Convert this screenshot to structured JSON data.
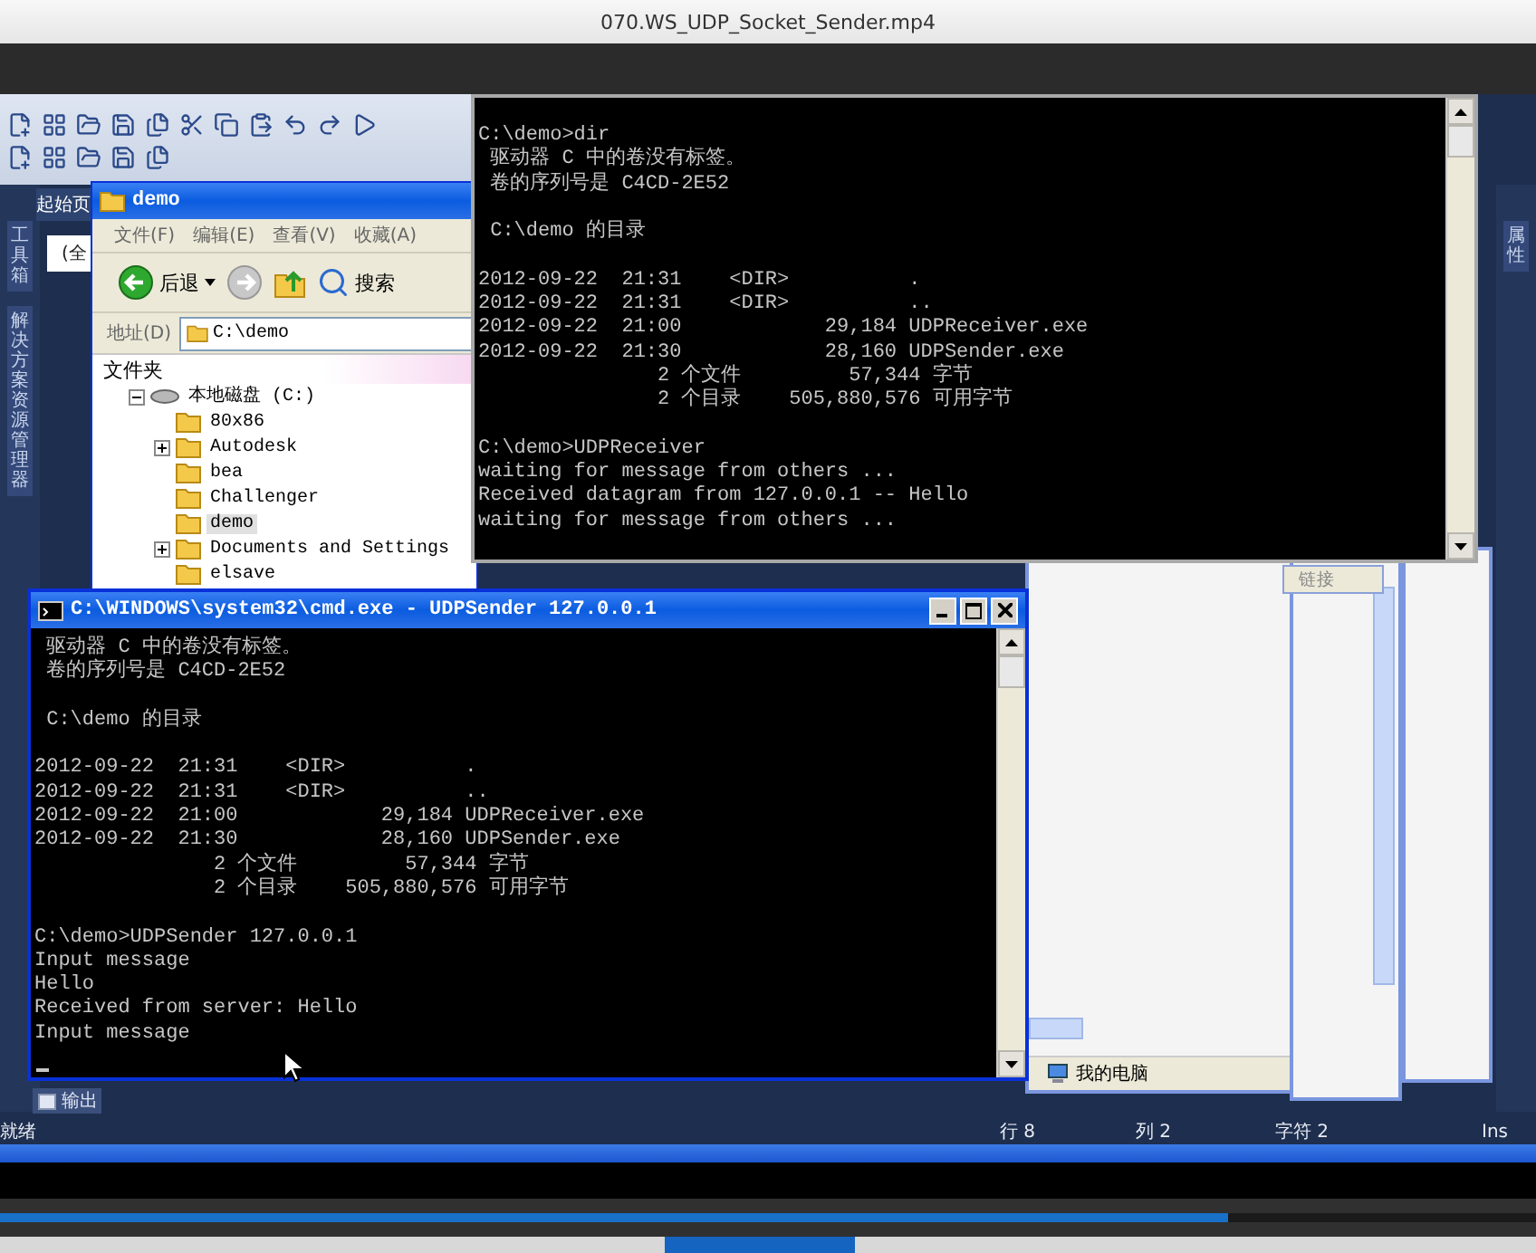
{
  "player": {
    "title": "070.WS_UDP_Socket_Sender.mp4",
    "progress": {
      "level": 0.8
    }
  },
  "ide": {
    "left_panels": [
      "工具箱",
      "解决方案资源管理器"
    ],
    "right_panels": [
      "属性"
    ],
    "start_tab": "起始页",
    "field_text": "(全",
    "output_tab": "输出",
    "status_bar": [
      "就绪",
      "行 8",
      "列 2",
      "字符 2",
      "Ins"
    ]
  },
  "explorer": {
    "title": "demo",
    "menu": [
      "文件(F)",
      "编辑(E)",
      "查看(V)",
      "收藏(A)"
    ],
    "back": "后退",
    "search": "搜索",
    "address_label": "地址(D)",
    "address": "C:\\demo",
    "folders_title": "文件夹",
    "tree": {
      "label": "本地磁盘 (C:)",
      "expanded": true,
      "children": [
        {
          "label": "80x86",
          "expandable": false,
          "selected": false
        },
        {
          "label": "Autodesk",
          "expandable": true,
          "selected": false
        },
        {
          "label": "bea",
          "expandable": false,
          "selected": false
        },
        {
          "label": "Challenger",
          "expandable": false,
          "selected": false
        },
        {
          "label": "demo",
          "expandable": false,
          "selected": true
        },
        {
          "label": "Documents and Settings",
          "expandable": true,
          "selected": false
        },
        {
          "label": "elsave",
          "expandable": false,
          "selected": false
        }
      ]
    }
  },
  "receiver_console": {
    "blocks": [
      [
        "C:\\demo>dir",
        " 驱动器 C 中的卷没有标签。",
        " 卷的序列号是 C4CD-2E52"
      ],
      [
        " C:\\demo 的目录"
      ],
      [
        "2012-09-22  21:31    <DIR>          .",
        "2012-09-22  21:31    <DIR>          ..",
        "2012-09-22  21:00            29,184 UDPReceiver.exe",
        "2012-09-22  21:30            28,160 UDPSender.exe",
        "               2 个文件         57,344 字节",
        "               2 个目录    505,880,576 可用字节"
      ],
      [
        "C:\\demo>UDPReceiver",
        "waiting for message from others ...",
        "Received datagram from 127.0.0.1 -- Hello",
        "waiting for message from others ..."
      ]
    ]
  },
  "sender_console": {
    "title": "C:\\WINDOWS\\system32\\cmd.exe - UDPSender 127.0.0.1",
    "blocks": [
      [
        " 驱动器 C 中的卷没有标签。",
        " 卷的序列号是 C4CD-2E52"
      ],
      [
        " C:\\demo 的目录"
      ],
      [
        "2012-09-22  21:31    <DIR>          .",
        "2012-09-22  21:31    <DIR>          ..",
        "2012-09-22  21:00            29,184 UDPReceiver.exe",
        "2012-09-22  21:30            28,160 UDPSender.exe",
        "               2 个文件         57,344 字节",
        "               2 个目录    505,880,576 可用字节"
      ],
      [
        "C:\\demo>UDPSender 127.0.0.1",
        "Input message",
        "Hello",
        "Received from server: Hello",
        "Input message"
      ]
    ]
  },
  "background_windows": {
    "status_text": "我的电脑",
    "links_label": "链接"
  }
}
